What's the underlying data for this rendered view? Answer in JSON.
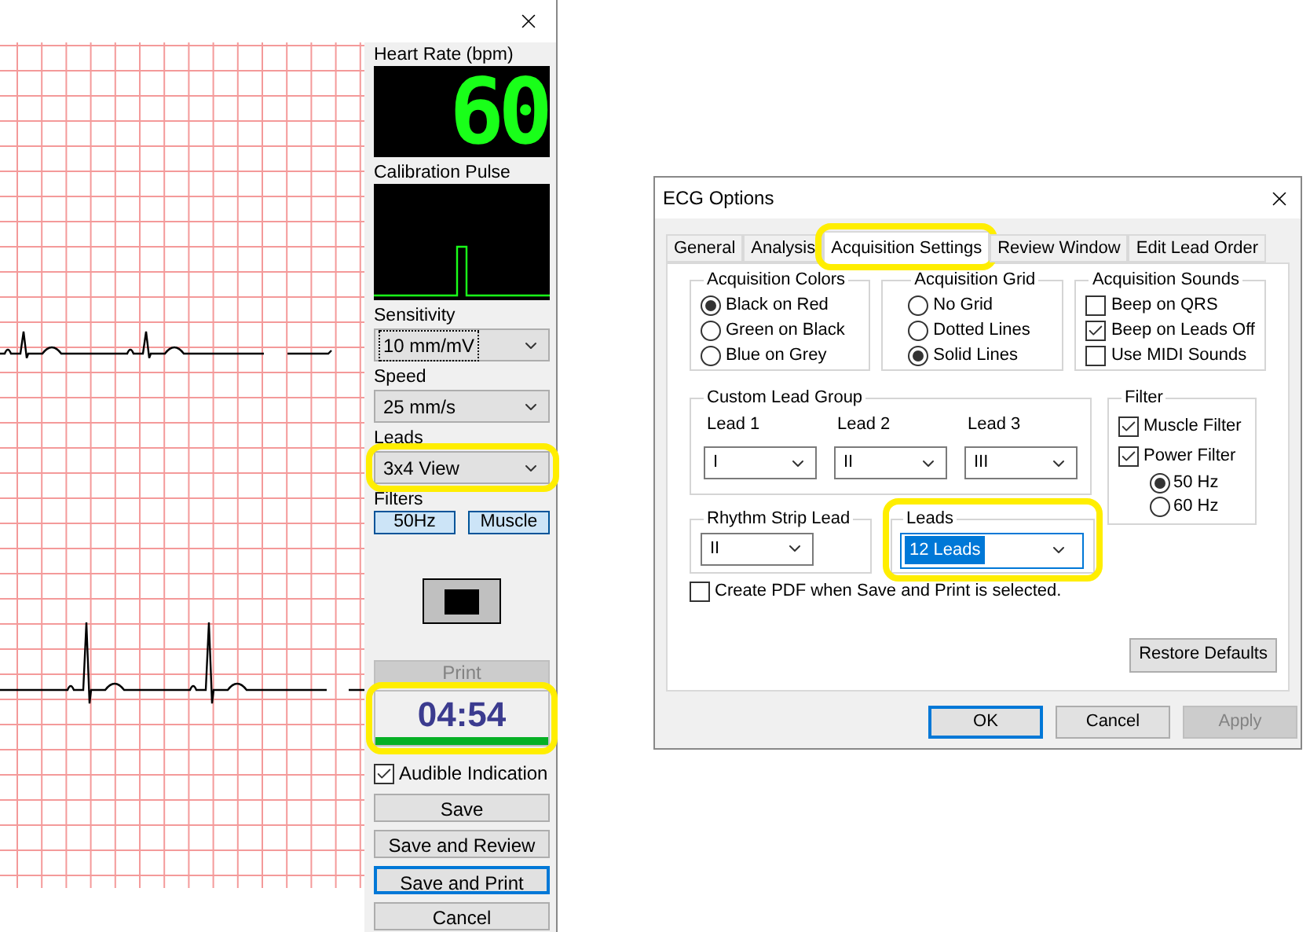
{
  "ecg_window": {
    "heart_rate": {
      "label": "Heart Rate (bpm)",
      "value": "60"
    },
    "calibration": {
      "label": "Calibration Pulse"
    },
    "selects": [
      {
        "label": "Sensitivity",
        "value": "10 mm/mV",
        "focused": true,
        "highlighted": false
      },
      {
        "label": "Speed",
        "value": "25 mm/s",
        "focused": false,
        "highlighted": false
      },
      {
        "label": "Leads",
        "value": "3x4 View",
        "focused": false,
        "highlighted": true
      }
    ],
    "filters": {
      "label": "Filters",
      "buttons": [
        {
          "label": "50Hz",
          "on": true
        },
        {
          "label": "Muscle",
          "on": true
        }
      ]
    },
    "print": {
      "label": "Print",
      "disabled": true
    },
    "timer": {
      "value": "04:54",
      "level": 1,
      "highlighted": true
    },
    "audible": {
      "label": "Audible Indication",
      "checked": true
    },
    "buttons": [
      {
        "label": "Save",
        "default": false
      },
      {
        "label": "Save and Review",
        "default": false
      },
      {
        "label": "Save and Print",
        "default": true
      },
      {
        "label": "Cancel",
        "default": false
      }
    ]
  },
  "ecg_options": {
    "title": "ECG Options",
    "tabs": [
      {
        "label": "General",
        "selected": false,
        "highlighted": false
      },
      {
        "label": "Analysis",
        "selected": false,
        "highlighted": false
      },
      {
        "label": "Acquisition Settings",
        "selected": true,
        "highlighted": true
      },
      {
        "label": "Review Window",
        "selected": false,
        "highlighted": false
      },
      {
        "label": "Edit Lead Order",
        "selected": false,
        "highlighted": false
      }
    ],
    "acquisition_colors": {
      "title": "Acquisition Colors",
      "options": [
        {
          "label": "Black on Red",
          "selected": true
        },
        {
          "label": "Green on Black",
          "selected": false
        },
        {
          "label": "Blue on Grey",
          "selected": false
        }
      ]
    },
    "acquisition_grid": {
      "title": "Acquisition Grid",
      "options": [
        {
          "label": "No Grid",
          "selected": false
        },
        {
          "label": "Dotted Lines",
          "selected": false
        },
        {
          "label": "Solid Lines",
          "selected": true
        }
      ]
    },
    "acquisition_sounds": {
      "title": "Acquisition Sounds",
      "options": [
        {
          "label": "Beep on QRS",
          "checked": false
        },
        {
          "label": "Beep on Leads Off",
          "checked": true
        },
        {
          "label": "Use MIDI Sounds",
          "checked": false
        }
      ]
    },
    "custom_lead_group": {
      "title": "Custom Lead Group",
      "leads": [
        {
          "label": "Lead 1",
          "value": "I"
        },
        {
          "label": "Lead 2",
          "value": "II"
        },
        {
          "label": "Lead 3",
          "value": "III"
        }
      ]
    },
    "filter": {
      "title": "Filter",
      "options": [
        {
          "label": "Muscle Filter",
          "checked": true
        },
        {
          "label": "Power Filter",
          "checked": true
        }
      ],
      "frequencies": [
        {
          "label": "50 Hz",
          "selected": true
        },
        {
          "label": "60 Hz",
          "selected": false
        }
      ]
    },
    "rhythm_strip_lead": {
      "title": "Rhythm Strip Lead",
      "value": "II"
    },
    "leads": {
      "title": "Leads",
      "value": "12 Leads",
      "text_selected": true,
      "highlighted": true
    },
    "create_pdf": {
      "label": "Create PDF when Save and Print is selected.",
      "checked": false
    },
    "restore_defaults": "Restore Defaults",
    "buttons": [
      {
        "label": "OK",
        "default": true,
        "disabled": false
      },
      {
        "label": "Cancel",
        "default": false,
        "disabled": false
      },
      {
        "label": "Apply",
        "default": false,
        "disabled": true
      }
    ]
  }
}
